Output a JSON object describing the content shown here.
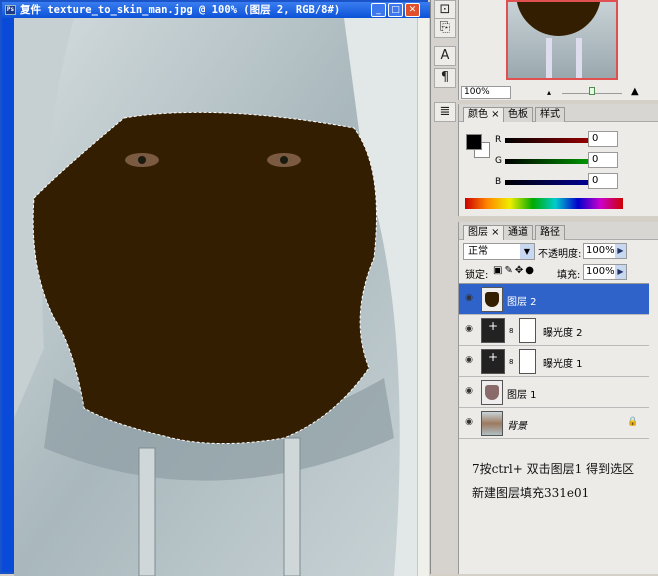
{
  "document": {
    "title": "复件 texture_to_skin_man.jpg @ 100% (图层 2, RGB/8#)",
    "fill_color": "#331e01"
  },
  "navigator": {
    "zoom": "100%"
  },
  "color_panel": {
    "tabs": [
      "颜色",
      "色板",
      "样式"
    ],
    "channels": [
      {
        "label": "R",
        "value": "0",
        "color": "#c00000"
      },
      {
        "label": "G",
        "value": "0",
        "color": "#00c000"
      },
      {
        "label": "B",
        "value": "0",
        "color": "#0000c0"
      }
    ],
    "foreground": "#000000",
    "background": "#ffffff"
  },
  "layers_panel": {
    "tabs": [
      "图层",
      "通道",
      "路径"
    ],
    "blend_mode": "正常",
    "opacity_label": "不透明度:",
    "opacity": "100%",
    "lock_label": "锁定:",
    "fill_label": "填充:",
    "fill": "100%",
    "layers": [
      {
        "name": "图层 2",
        "selected": true
      },
      {
        "name": "曝光度 2",
        "selected": false
      },
      {
        "name": "曝光度 1",
        "selected": false
      },
      {
        "name": "图层 1",
        "selected": false
      },
      {
        "name": "背景",
        "selected": false,
        "locked": true
      }
    ],
    "notes": [
      "7按ctrl+ 双击图层1   得到选区",
      "新建图层填充331e01"
    ]
  }
}
